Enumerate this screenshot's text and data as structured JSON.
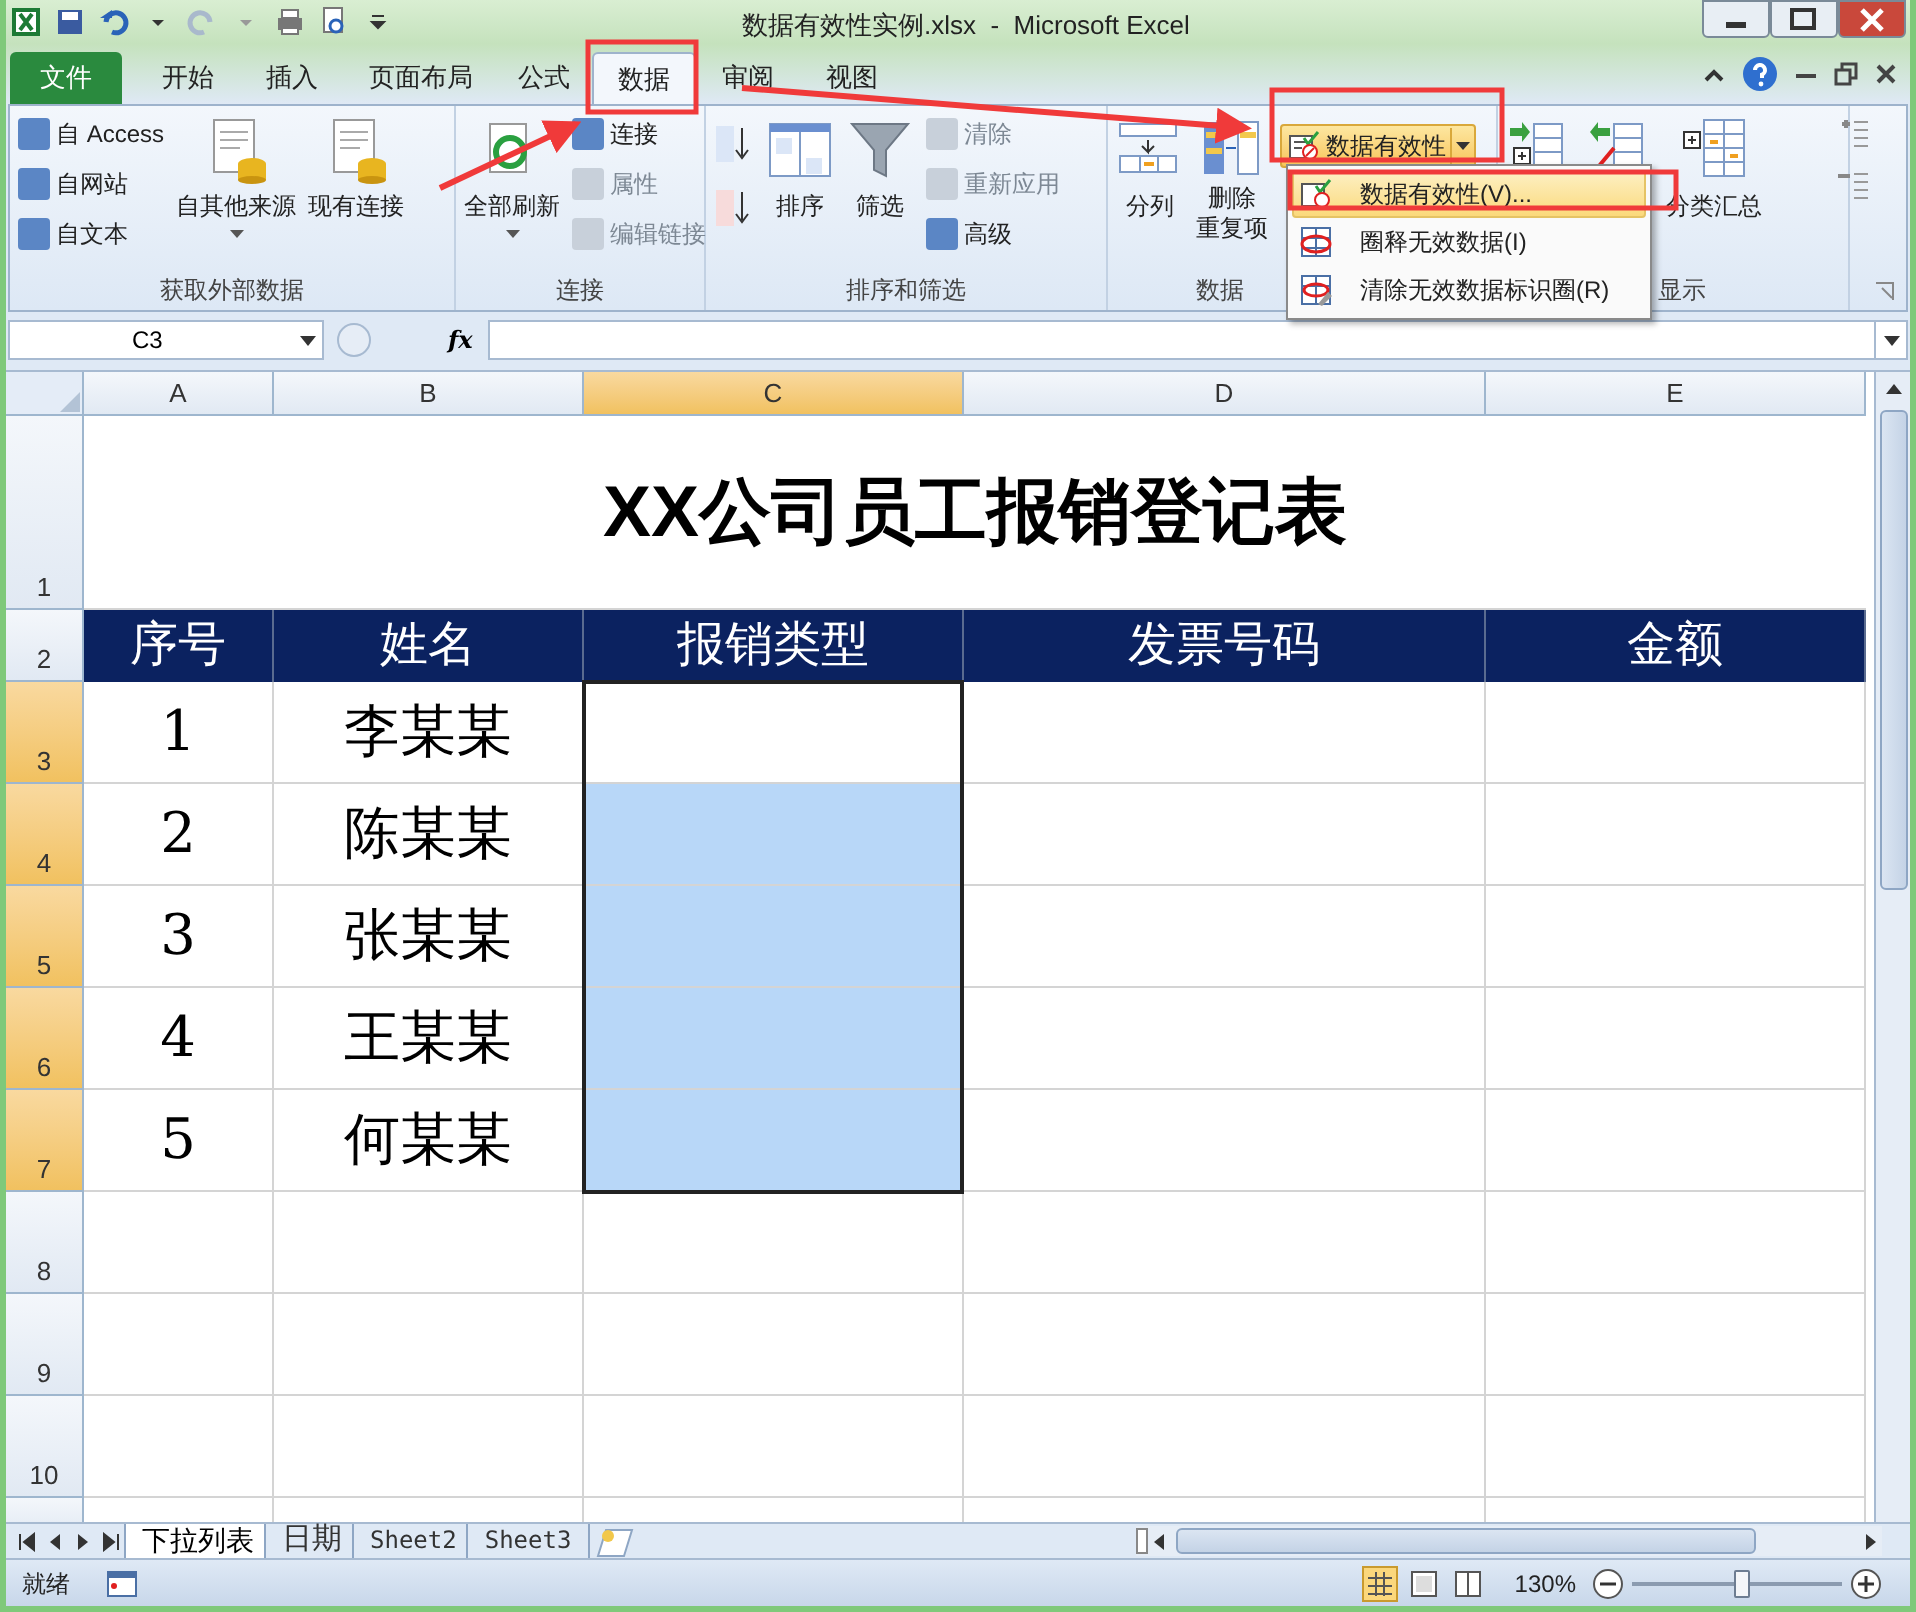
{
  "window": {
    "title": "数据有效性实例.xlsx  -  Microsoft Excel"
  },
  "tabs": [
    {
      "label": "文件",
      "kind": "file",
      "selected": false
    },
    {
      "label": "开始",
      "kind": "tab",
      "selected": false
    },
    {
      "label": "插入",
      "kind": "tab",
      "selected": false
    },
    {
      "label": "页面布局",
      "kind": "tab",
      "selected": false
    },
    {
      "label": "公式",
      "kind": "tab",
      "selected": false
    },
    {
      "label": "数据",
      "kind": "tab",
      "selected": true
    },
    {
      "label": "审阅",
      "kind": "tab",
      "selected": false
    },
    {
      "label": "视图",
      "kind": "tab",
      "selected": false
    }
  ],
  "ribbon": {
    "groups": [
      {
        "label": "获取外部数据",
        "buttons": [
          {
            "kind": "small",
            "label": "自 Access",
            "disabled": false
          },
          {
            "kind": "small",
            "label": "自网站",
            "disabled": false
          },
          {
            "kind": "small",
            "label": "自文本",
            "disabled": false
          },
          {
            "kind": "large",
            "label": "自其他来源",
            "disabled": false,
            "dropdown": true
          },
          {
            "kind": "large",
            "label": "现有连接",
            "disabled": false,
            "dropdown": false
          }
        ]
      },
      {
        "label": "连接",
        "buttons": [
          {
            "kind": "large",
            "label": "全部刷新",
            "disabled": false,
            "dropdown": true
          },
          {
            "kind": "small",
            "label": "连接",
            "disabled": false
          },
          {
            "kind": "small",
            "label": "属性",
            "disabled": true
          },
          {
            "kind": "small",
            "label": "编辑链接",
            "disabled": true
          }
        ]
      },
      {
        "label": "排序和筛选",
        "buttons": [
          {
            "kind": "sorticon",
            "disabled": false
          },
          {
            "kind": "large",
            "label": "排序",
            "disabled": false,
            "dropdown": false
          },
          {
            "kind": "large",
            "label": "筛选",
            "disabled": false,
            "dropdown": false
          },
          {
            "kind": "small",
            "label": "清除",
            "disabled": true
          },
          {
            "kind": "small",
            "label": "重新应用",
            "disabled": true
          },
          {
            "kind": "small",
            "label": "高级",
            "disabled": false
          }
        ]
      },
      {
        "label": "数据",
        "buttons": [
          {
            "kind": "large",
            "label": "分列",
            "disabled": false,
            "dropdown": false
          },
          {
            "kind": "large",
            "lines": [
              "删除",
              "重复项"
            ],
            "disabled": false,
            "dropdown": false
          },
          {
            "kind": "split",
            "label": "数据有效性",
            "disabled": false
          }
        ]
      },
      {
        "label": "显示",
        "buttons": [
          {
            "kind": "iconlarge",
            "disabled": false
          },
          {
            "kind": "iconlarge",
            "disabled": false
          },
          {
            "kind": "large",
            "label": "分类汇总",
            "disabled": false,
            "dropdown": false
          }
        ]
      }
    ]
  },
  "menu": {
    "items": [
      {
        "label": "数据有效性(V)...",
        "selected": true
      },
      {
        "label": "圈释无效数据(I)",
        "selected": false
      },
      {
        "label": "清除无效数据标识圈(R)",
        "selected": false
      }
    ]
  },
  "formula_bar": {
    "name_box": "C3",
    "fx": "fx"
  },
  "sheet": {
    "columns": [
      {
        "label": "A",
        "selected": false
      },
      {
        "label": "B",
        "selected": false
      },
      {
        "label": "C",
        "selected": true
      },
      {
        "label": "D",
        "selected": false
      },
      {
        "label": "E",
        "selected": false
      }
    ],
    "title_row_number": "1",
    "title": "XX公司员工报销登记表",
    "header_row_number": "2",
    "header": [
      "序号",
      "姓名",
      "报销类型",
      "发票号码",
      "金额"
    ],
    "rows": [
      {
        "number": "3",
        "cells": [
          "1",
          "李某某"
        ],
        "selected": true,
        "highlighted": false
      },
      {
        "number": "4",
        "cells": [
          "2",
          "陈某某"
        ],
        "selected": true,
        "highlighted": true
      },
      {
        "number": "5",
        "cells": [
          "3",
          "张某某"
        ],
        "selected": true,
        "highlighted": true
      },
      {
        "number": "6",
        "cells": [
          "4",
          "王某某"
        ],
        "selected": true,
        "highlighted": true
      },
      {
        "number": "7",
        "cells": [
          "5",
          "何某某"
        ],
        "selected": true,
        "highlighted": true
      },
      {
        "number": "8",
        "selected": false,
        "highlighted": false
      },
      {
        "number": "9",
        "selected": false,
        "highlighted": false
      },
      {
        "number": "10",
        "selected": false,
        "highlighted": false
      }
    ]
  },
  "sheet_tabs": [
    {
      "label": "下拉列表",
      "selected": true
    },
    {
      "label": "日期",
      "selected": false
    },
    {
      "label": "Sheet2",
      "selected": false
    },
    {
      "label": "Sheet3",
      "selected": false
    }
  ],
  "status_bar": {
    "status": "就绪",
    "zoom": "130%",
    "zoom_level": {
      "level": 0.52
    }
  }
}
